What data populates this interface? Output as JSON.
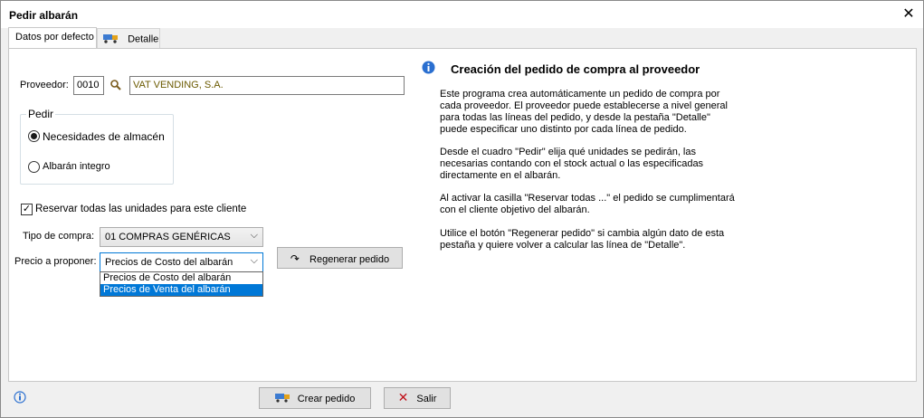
{
  "window": {
    "title": "Pedir albarán",
    "close_glyph": "✕"
  },
  "tabs": [
    {
      "label": "Datos por defecto",
      "active": true
    },
    {
      "label": "Detalle",
      "icon": "truck-icon",
      "active": false
    }
  ],
  "form": {
    "proveedor_label": "Proveedor:",
    "proveedor_code": "0010",
    "proveedor_name": "VAT VENDING, S.A.",
    "pedir": {
      "legend": "Pedir",
      "options": [
        {
          "label": "Necesidades de almacén",
          "checked": true
        },
        {
          "label": "Albarán integro",
          "checked": false
        }
      ]
    },
    "reservar_label": "Reservar todas las unidades para este cliente",
    "reservar_checked": true,
    "tipo_compra_label": "Tipo de compra:",
    "tipo_compra_value": "01 COMPRAS GENÉRICAS",
    "precio_label": "Precio a proponer:",
    "precio_value": "Precios de Costo del albarán",
    "precio_options": [
      {
        "label": "Precios de Costo del albarán",
        "highlighted": false
      },
      {
        "label": "Precios de Venta del albarán",
        "highlighted": true
      }
    ],
    "regenerar_label": "Regenerar pedido"
  },
  "info": {
    "title": "Creación del pedido de compra al proveedor",
    "paragraphs": [
      "Este programa crea automáticamente un pedido de compra por cada proveedor. El proveedor puede establecerse a nivel general para todas las líneas del pedido, y desde la pestaña \"Detalle\" puede especificar uno distinto por cada línea de pedido.",
      "Desde el cuadro \"Pedir\" elija qué unidades se pedirán, las necesarias contando con el stock actual o las especificadas directamente en el albarán.",
      "Al activar la casilla \"Reservar todas ...\" el pedido se cumplimentará con el cliente objetivo del albarán.",
      "Utilice el botón \"Regenerar pedido\" si cambia algún dato de esta pestaña y quiere volver a calcular las línea de \"Detalle\"."
    ]
  },
  "footer": {
    "crear_label": "Crear pedido",
    "salir_label": "Salir"
  },
  "colors": {
    "accent": "#0078d7",
    "info_icon": "#2a6fd0",
    "salir_icon": "#c0111a",
    "proveedor_name_text": "#6b5a00"
  }
}
